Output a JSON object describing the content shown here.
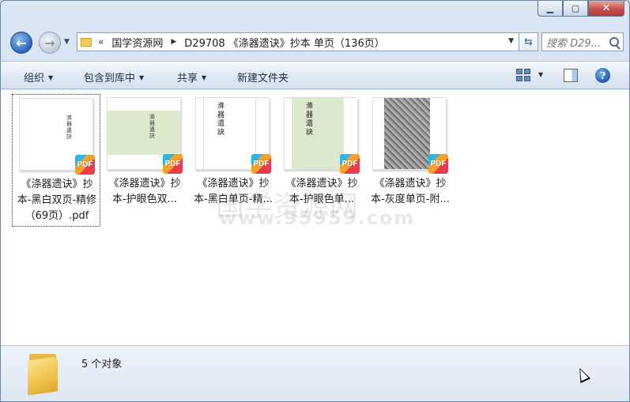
{
  "window": {
    "caption_icons": [
      "minimize-icon",
      "maximize-icon",
      "close-icon"
    ]
  },
  "nav": {
    "history_marker": "«",
    "breadcrumb": [
      "国学资源网",
      "D29708 《涤器遗诀》抄本 单页（136页）"
    ],
    "search_placeholder": "搜索 D29..."
  },
  "toolbar": {
    "organize": "组织",
    "include_in_library": "包含到库中",
    "share": "共享",
    "new_folder": "新建文件夹"
  },
  "files": [
    {
      "label": "《涤器遗诀》抄本-黑白双页-精修（69页）.pdf",
      "thumb_style": "white-double",
      "badge": "PDF"
    },
    {
      "label": "《涤器遗诀》抄本-护眼色双...",
      "thumb_style": "green-double",
      "badge": "PDF"
    },
    {
      "label": "《涤器遗诀》抄本-黑白单页-精...",
      "thumb_style": "white-single",
      "badge": "PDF"
    },
    {
      "label": "《涤器遗诀》抄本-护眼色单...",
      "thumb_style": "green-single",
      "badge": "PDF"
    },
    {
      "label": "《涤器遗诀》抄本-灰度单页-附...",
      "thumb_style": "gray-single",
      "badge": "PDF"
    }
  ],
  "thumb_glyphs": [
    "滌",
    "器",
    "遺",
    "訣"
  ],
  "watermark": {
    "text": "国学资源网",
    "url": "www.95959.com"
  },
  "details": {
    "count_text": "5 个对象"
  },
  "colors": {
    "accent": "#2a66b8",
    "eye_care_green": "#dde9cc",
    "close_red": "#c75050"
  }
}
